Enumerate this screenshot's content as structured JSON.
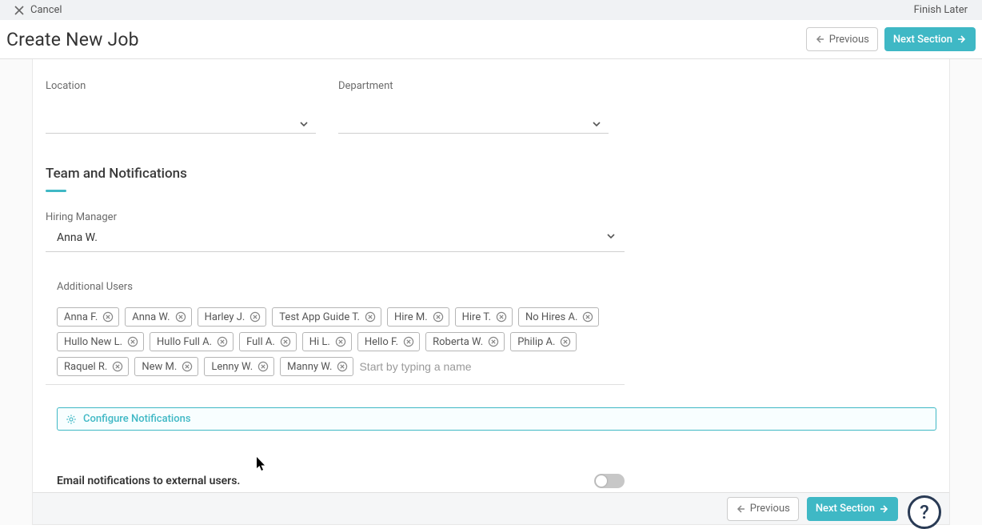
{
  "topbar": {
    "cancel_label": "Cancel",
    "finish_later_label": "Finish Later"
  },
  "header": {
    "title": "Create New Job",
    "previous_label": "Previous",
    "next_label": "Next Section"
  },
  "form": {
    "location_label": "Location",
    "department_label": "Department",
    "location_value": "",
    "department_value": ""
  },
  "team_section": {
    "title": "Team and Notifications",
    "hiring_manager_label": "Hiring Manager",
    "hiring_manager_value": "Anna W.",
    "additional_users_label": "Additional Users",
    "additional_users": [
      "Anna F.",
      "Anna W.",
      "Harley J.",
      "Test App Guide T.",
      "Hire M.",
      "Hire T.",
      "No Hires A.",
      "Hullo New L.",
      "Hullo Full A.",
      "Full A.",
      "Hi L.",
      "Hello F.",
      "Roberta W.",
      "Philip A.",
      "Raquel R.",
      "New M.",
      "Lenny W.",
      "Manny W."
    ],
    "additional_users_input_placeholder": "Start by typing a name",
    "configure_notifications_label": "Configure Notifications",
    "email_external_label": "Email notifications to external users.",
    "email_external_on": false
  },
  "footer": {
    "previous_label": "Previous",
    "next_label": "Next Section",
    "help_label": "?"
  },
  "colors": {
    "primary": "#3fb8c5",
    "text": "#333333",
    "muted": "#6b6b6b"
  }
}
